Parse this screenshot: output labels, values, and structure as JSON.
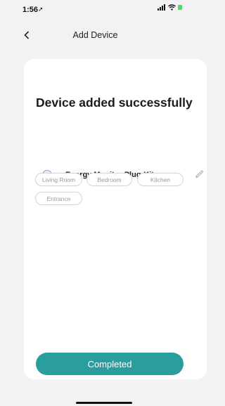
{
  "status_bar": {
    "time": "1:56"
  },
  "nav": {
    "title": "Add Device"
  },
  "main": {
    "headline": "Device added successfully",
    "device_name": "Energy Monitor Plug-Kitc...",
    "rooms": [
      "Living Room",
      "Bedroom",
      "Kitchen",
      "Entrance"
    ]
  },
  "footer": {
    "completed_label": "Completed"
  },
  "colors": {
    "accent": "#2a9d9f",
    "card": "#ffffff",
    "background": "#f2f2f4"
  }
}
